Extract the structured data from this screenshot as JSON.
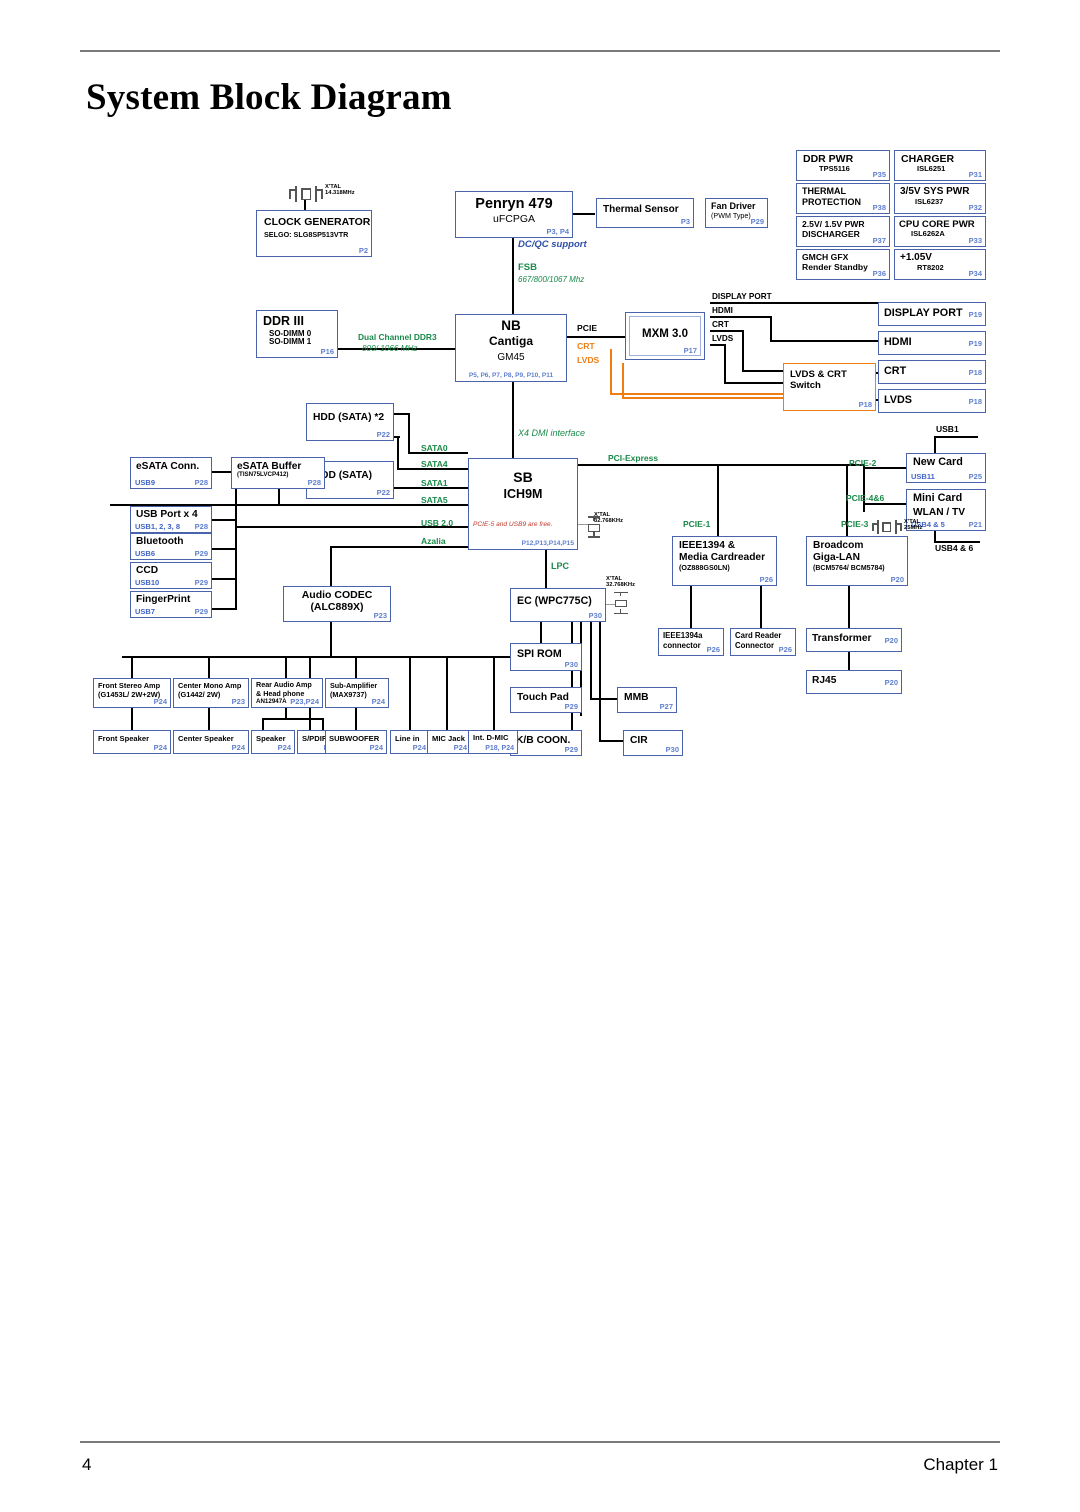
{
  "document": {
    "title": "System Block Diagram",
    "footer_page": "4",
    "footer_chapter": "Chapter 1"
  },
  "colors": {
    "box_border": "#4a63ad",
    "page_ref": "#5f7fd0",
    "usb_label": "#3f63c8",
    "signal_green": "#1a8a4a",
    "orange_bus": "#f07d12",
    "note_red": "#c0392b"
  },
  "blocks": {
    "clock_generator": {
      "title": "CLOCK GENERATOR",
      "sub": "SELGO: SLG8SP513VTR",
      "page": "P2"
    },
    "xtal_clock": {
      "label1": "X'TAL",
      "label2": "14.318MHz"
    },
    "penryn": {
      "title": "Penryn 479",
      "sub": "uFCPGA",
      "page": "P3, P4"
    },
    "thermal_sensor": {
      "title": "Thermal Sensor",
      "page": "P3"
    },
    "fan_driver": {
      "title": "Fan Driver",
      "sub": "(PWM Type)",
      "page": "P29"
    },
    "ddr3": {
      "title": "DDR III",
      "sub1": "SO-DIMM 0",
      "sub2": "SO-DIMM 1",
      "page": "P16"
    },
    "nb": {
      "title": "NB",
      "sub1": "Cantiga",
      "sub2": "GM45",
      "page": "P5, P6, P7, P8, P9, P10, P11"
    },
    "mxm": {
      "title": "MXM 3.0",
      "page": "P17"
    },
    "lvds_crt_switch": {
      "title": "LVDS & CRT",
      "sub": "Switch",
      "page": "P18"
    },
    "display_port": {
      "title": "DISPLAY PORT",
      "page": "P19"
    },
    "hdmi": {
      "title": "HDMI",
      "page": "P19"
    },
    "crt": {
      "title": "CRT",
      "page": "P18"
    },
    "lvds": {
      "title": "LVDS",
      "page": "P18"
    },
    "hdd_sata": {
      "title": "HDD (SATA) *2",
      "page": "P22"
    },
    "odd_sata": {
      "title": "ODD (SATA)",
      "page": "P22"
    },
    "esata_conn": {
      "title": "eSATA Conn.",
      "usb": "USB9",
      "page": "P28"
    },
    "esata_buffer": {
      "title": "eSATA Buffer",
      "sub": "(TISN75LVCP412)",
      "page": "P28"
    },
    "usb_port": {
      "title": "USB Port x 4",
      "usb": "USB1, 2, 3, 8",
      "page": "P28"
    },
    "bluetooth": {
      "title": "Bluetooth",
      "usb": "USB6",
      "page": "P29"
    },
    "ccd": {
      "title": "CCD",
      "usb": "USB10",
      "page": "P29"
    },
    "fingerprint": {
      "title": "FingerPrint",
      "usb": "USB7",
      "page": "P29"
    },
    "sb": {
      "title": "SB",
      "sub": "ICH9M",
      "note": "PCIE-5 and USB9 are free.",
      "page": "P12,P13,P14,P15"
    },
    "xtal_sb": {
      "label1": "X'TAL",
      "label2": "32.768KHz"
    },
    "audio_codec": {
      "title": "Audio CODEC",
      "sub": "(ALC889X)",
      "page": "P23"
    },
    "ec": {
      "title": "EC (WPC775C)",
      "page": "P30"
    },
    "xtal_ec": {
      "label1": "X'TAL",
      "label2": "32.768KHz"
    },
    "spi_rom": {
      "title": "SPI ROM",
      "page": "P30"
    },
    "touch_pad": {
      "title": "Touch Pad",
      "page": "P29"
    },
    "mmb": {
      "title": "MMB",
      "page": "P27"
    },
    "kb_coon": {
      "title": "K/B COON.",
      "page": "P29"
    },
    "cir": {
      "title": "CIR",
      "page": "P30"
    },
    "ieee1394_cardreader": {
      "title1": "IEEE1394 &",
      "title2": "Media Cardreader",
      "sub": "(OZ888GS0LN)",
      "page": "P26"
    },
    "ieee1394a_conn": {
      "title1": "IEEE1394a",
      "title2": "connector",
      "page": "P26"
    },
    "card_reader_conn": {
      "title1": "Card Reader",
      "title2": "Connector",
      "page": "P26"
    },
    "broadcom": {
      "title1": "Broadcom",
      "title2": "Giga-LAN",
      "sub": "(BCM5764/ BCM5784)",
      "page": "P20"
    },
    "xtal_lan": {
      "label1": "X'TAL",
      "label2": "25MHz"
    },
    "transformer": {
      "title": "Transformer",
      "page": "P20"
    },
    "rj45": {
      "title": "RJ45",
      "page": "P20"
    },
    "new_card": {
      "title": "New Card",
      "usb": "USB11",
      "page": "P25"
    },
    "mini_card": {
      "title1": "Mini Card",
      "title2": "WLAN / TV",
      "usb": "USB4 & 5",
      "page": "P21"
    },
    "front_stereo_amp": {
      "title": "Front Stereo Amp",
      "sub": "(G1453L/ 2W+2W)",
      "page": "P24"
    },
    "center_mono_amp": {
      "title": "Center Mono Amp",
      "sub": "(G1442/ 2W)",
      "page": "P23"
    },
    "rear_audio_amp": {
      "title1": "Rear Audio Amp",
      "title2": "& Head phone",
      "sub": "AN12947A",
      "page": "P23,P24"
    },
    "sub_amplifier": {
      "title": "Sub-Amplifier",
      "sub": "(MAX9737)",
      "page": "P24"
    },
    "front_speaker": {
      "title": "Front Speaker",
      "page": "P24"
    },
    "center_speaker": {
      "title": "Center Speaker",
      "page": "P24"
    },
    "speaker": {
      "title": "Speaker",
      "page": "P24"
    },
    "spdif": {
      "title": "S/PDIF",
      "page": "P24"
    },
    "subwoofer": {
      "title": "SUBWOOFER",
      "page": "P24"
    },
    "line_in": {
      "title": "Line in",
      "page": "P24"
    },
    "mic_jack": {
      "title": "MIC Jack",
      "page": "P24"
    },
    "int_dmic": {
      "title": "Int. D-MIC",
      "page": "P18, P24"
    },
    "ddr_pwr": {
      "title": "DDR PWR",
      "sub": "TPS5116",
      "page": "P35"
    },
    "charger": {
      "title": "CHARGER",
      "sub": "ISL6251",
      "page": "P31"
    },
    "thermal_protection": {
      "title1": "THERMAL",
      "title2": "PROTECTION",
      "page": "P38"
    },
    "sys_pwr_35v": {
      "title": "3/5V SYS PWR",
      "sub": "ISL6237",
      "page": "P32"
    },
    "pwr_discharger": {
      "title1": "2.5V/ 1.5V PWR",
      "title2": "DISCHARGER",
      "page": "P37"
    },
    "cpu_core_pwr": {
      "title": "CPU CORE PWR",
      "sub": "ISL6262A",
      "page": "P33"
    },
    "gmch_gfx": {
      "title1": "GMCH  GFX",
      "title2": "Render Standby",
      "page": "P36"
    },
    "v105": {
      "title": "+1.05V",
      "sub": "RT8202",
      "page": "P34"
    }
  },
  "signals": {
    "dc_qc_support": "DC/QC support",
    "fsb": "FSB",
    "fsb_speed": "667/800/1067 Mhz",
    "dual_channel": "Dual Channel DDR3",
    "dual_channel_speed": "800/ 1066 MHz",
    "pcie": "PCIE",
    "crt": "CRT",
    "lvds": "LVDS",
    "display_port": "DISPLAY PORT",
    "hdmi": "HDMI",
    "crt2": "CRT",
    "lvds2": "LVDS",
    "dmi": "X4 DMI interface",
    "sata0": "SATA0",
    "sata4": "SATA4",
    "sata1": "SATA1",
    "sata5": "SATA5",
    "usb20": "USB 2.0",
    "azalia": "Azalia",
    "lpc": "LPC",
    "pci_express": "PCI-Express",
    "pcie1": "PCIE-1",
    "pcie2": "PCIE-2",
    "pcie3": "PCIE-3",
    "pcie46": "PCIE-4&6",
    "usb1": "USB1",
    "usb46": "USB4 & 6"
  }
}
